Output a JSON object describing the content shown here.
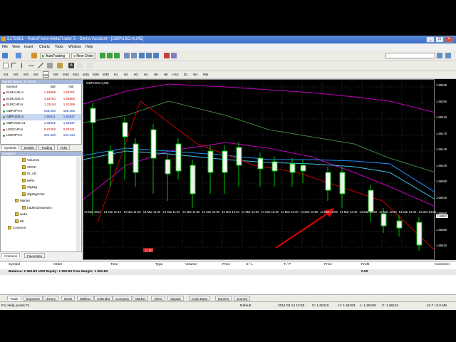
{
  "window": {
    "title": "2175951 - RoboForex-MetaTrader 5 - Demo Account - [GBPUSD.m,M5]",
    "min": "_",
    "max": "□",
    "close": "×"
  },
  "menu": [
    "File",
    "View",
    "Insert",
    "Charts",
    "Tools",
    "Window",
    "Help"
  ],
  "toolbar": {
    "autotrading": "AutoTrading",
    "new_order": "New Order"
  },
  "timeframes": [
    "M1",
    "M2",
    "M3",
    "M4",
    "M5",
    "M6",
    "M10",
    "M12",
    "M15",
    "M20",
    "M30",
    "H1",
    "H2",
    "H3",
    "H4",
    "H6",
    "H8",
    "H12",
    "D1",
    "W1",
    "MN"
  ],
  "timeframe_selected": "M5",
  "market_watch": {
    "header": "Market Watch: 17:40:04",
    "col_symbol": "Symbol",
    "col_bid": "Bid",
    "col_ask": "Ask",
    "rows": [
      {
        "symbol": "EURAUD.m",
        "bid": "1.53669",
        "ask": "1.53701",
        "color": "#c00000"
      },
      {
        "symbol": "EURUSD.m",
        "bid": "1.53784",
        "ask": "1.53800",
        "color": "#c00000"
      },
      {
        "symbol": "EURCHF.m",
        "bid": "1.21194",
        "ask": "1.21365",
        "color": "#c00000"
      },
      {
        "symbol": "GBPJPY.m",
        "bid": "168.283",
        "ask": "168.306",
        "color": "#1030a0"
      },
      {
        "symbol": "GBPUSD.m",
        "bid": "1.65921",
        "ask": "1.65937",
        "color": "#1030a0"
      },
      {
        "symbol": "GBPUSD.m1",
        "bid": "1.65921",
        "ask": "1.65937",
        "color": "#1030a0"
      },
      {
        "symbol": "USDCHF.m",
        "bid": "0.87403",
        "ask": "0.87421",
        "color": "#c00000"
      },
      {
        "symbol": "USDJPY.m",
        "bid": "101.420",
        "ask": "101.434",
        "color": "#1030a0"
      }
    ],
    "tabs": [
      "Symbols",
      "Details",
      "Trading",
      "Ticks"
    ]
  },
  "navigator": {
    "header": "Navigator",
    "items": [
      "Volumes",
      "VROC",
      "W_AD",
      "WPR",
      "ZigZag",
      "ZigZagColor",
      "Market",
      "tradersdreamsEA",
      "an4a",
      "88",
      "Common"
    ],
    "tabs": [
      "Common",
      "Favourites"
    ]
  },
  "chart": {
    "title": "GBPUSD.m,M5",
    "price_labels": [
      "1.66290",
      "1.66250",
      "1.66210",
      "1.66170",
      "1.66140",
      "1.66100",
      "1.66060",
      "1.66020",
      "1.65990",
      "1.65950",
      "1.65910"
    ],
    "time_labels": [
      "14 Mar 2014",
      "14 Mar 11:10",
      "14 Mar 11:20",
      "14 Mar 11:30",
      "14 Mar 11:40",
      "14 Mar 11:50",
      "14 Mar 12:00",
      "14 Mar 12:10",
      "14 Mar 12:20",
      "14 Mar 12:30",
      "14 Mar 12:40",
      "14 Mar 12:50",
      "14 Mar 13:00",
      "14 Mar 13:10",
      "14 Mar 13:20",
      "14 Mar 13:30",
      "14 Mar 13:40",
      "14 Mar 13:50"
    ],
    "marker_label": "11:00",
    "current_price": "1.65921",
    "colors": {
      "bull": "#ffffff",
      "bear": "#000000",
      "wick": "#00c000",
      "ma_blue": "#1e90ff",
      "band_magenta": "#c000c0",
      "band_red": "#c00000",
      "arrow": "#e00000"
    }
  },
  "terminal": {
    "columns": [
      "Symbol",
      "Order",
      "Time",
      "Type",
      "Volume",
      "Price",
      "S / L",
      "T / P",
      "Price",
      "Profit",
      "Comment"
    ],
    "balance": "Balance: 1 592.83 USD   Equity: 1 592.83   Free Margin: 1 592.83",
    "profit_total": "0.00",
    "tabs": [
      "Trade",
      "Exposure",
      "History",
      "News",
      "Mailbox",
      "Calendar",
      "Company",
      "Market",
      "Alerts",
      "Signals",
      "Code Base",
      "Experts",
      "Journal"
    ]
  },
  "status": {
    "help": "For Help, press F1",
    "profile": "Default",
    "datetime": "2014.03.14 12:50",
    "open": "O: 1.66110",
    "high": "H: 1.66183",
    "low": "L: 1.66106",
    "close": "C: 1.66141",
    "traffic": "24.7 / 0.0 Mb"
  }
}
